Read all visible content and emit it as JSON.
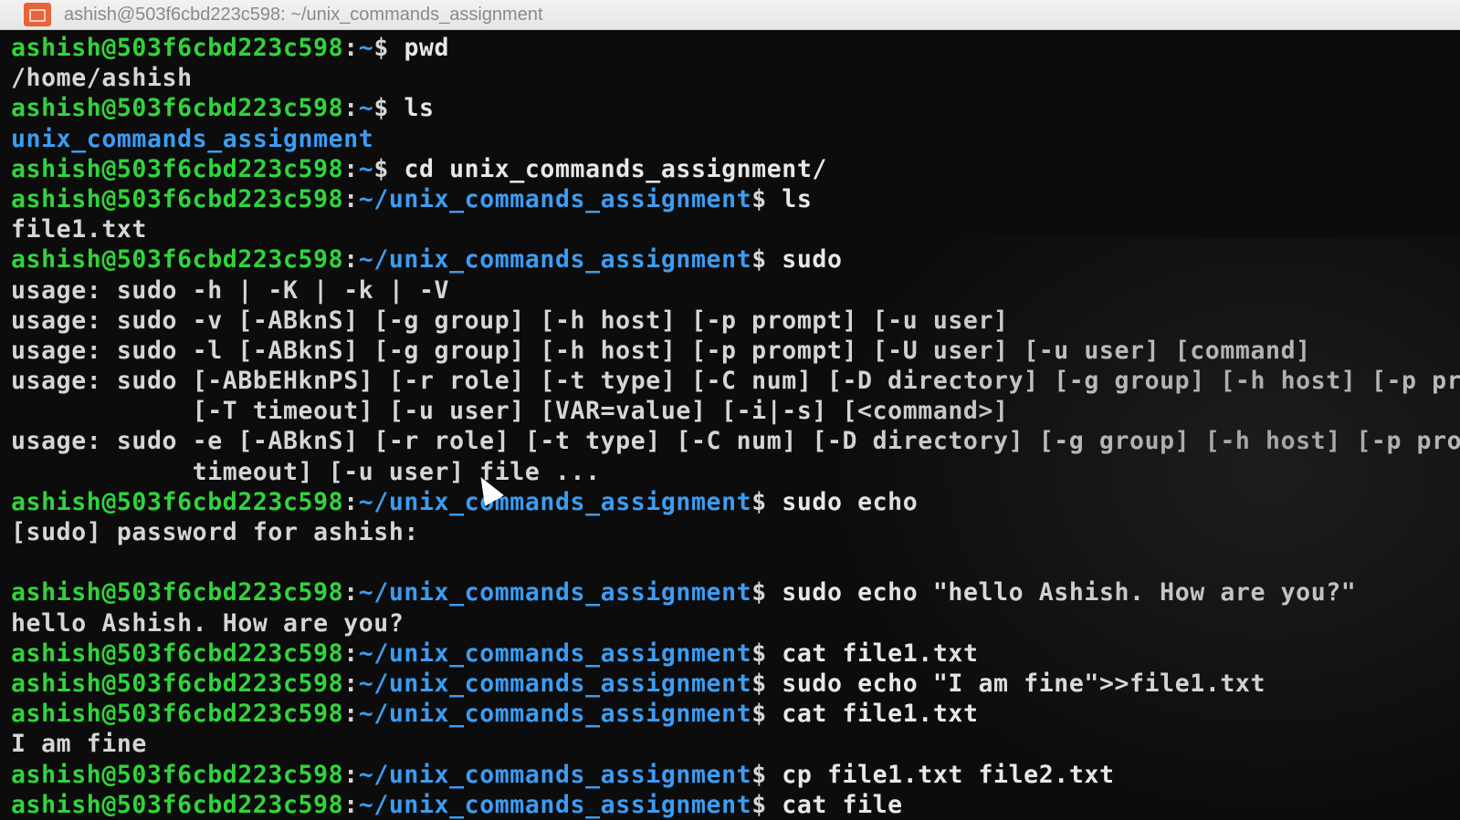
{
  "window": {
    "title": "ashish@503f6cbd223c598: ~/unix_commands_assignment",
    "icon": "terminal-app-icon"
  },
  "prompt": {
    "user_host": "ashish@503f6cbd223c598",
    "separator": ":",
    "home_path": "~",
    "project_path": "~/unix_commands_assignment",
    "symbol": "$ "
  },
  "lines": {
    "l01_cmd": "pwd",
    "l02_out": "/home/ashish",
    "l03_cmd": "ls",
    "l04_dir": "unix_commands_assignment",
    "l05_cmd": "cd unix_commands_assignment/",
    "l06_cmd": "ls",
    "l07_out": "file1.txt",
    "l08_cmd": "sudo",
    "l09_out": "usage: sudo -h | -K | -k | -V",
    "l10_out": "usage: sudo -v [-ABknS] [-g group] [-h host] [-p prompt] [-u user]",
    "l11_out": "usage: sudo -l [-ABknS] [-g group] [-h host] [-p prompt] [-U user] [-u user] [command]",
    "l12_out": "usage: sudo [-ABbEHknPS] [-r role] [-t type] [-C num] [-D directory] [-g group] [-h host] [-p pro",
    "l13_out": "            [-T timeout] [-u user] [VAR=value] [-i|-s] [<command>]",
    "l14_out": "usage: sudo -e [-ABknS] [-r role] [-t type] [-C num] [-D directory] [-g group] [-h host] [-p pron",
    "l15_out": "            timeout] [-u user] file ...",
    "l16_cmd": "sudo echo",
    "l17_out": "[sudo] password for ashish:",
    "l18_out": "",
    "l19_cmd": "sudo echo \"hello Ashish. How are you?\"",
    "l20_out": "hello Ashish. How are you?",
    "l21_cmd": "cat file1.txt",
    "l22_cmd": "sudo echo \"I am fine\">>file1.txt",
    "l23_cmd": "cat file1.txt",
    "l24_out": "I am fine",
    "l25_cmd": "cp file1.txt file2.txt",
    "l26_cmd": "cat file"
  },
  "colors": {
    "background": "#0c0c0c",
    "user_host": "#31d43b",
    "path": "#3c9cf2",
    "text": "#d6d6d6",
    "titlebar": "#eaeaea"
  }
}
